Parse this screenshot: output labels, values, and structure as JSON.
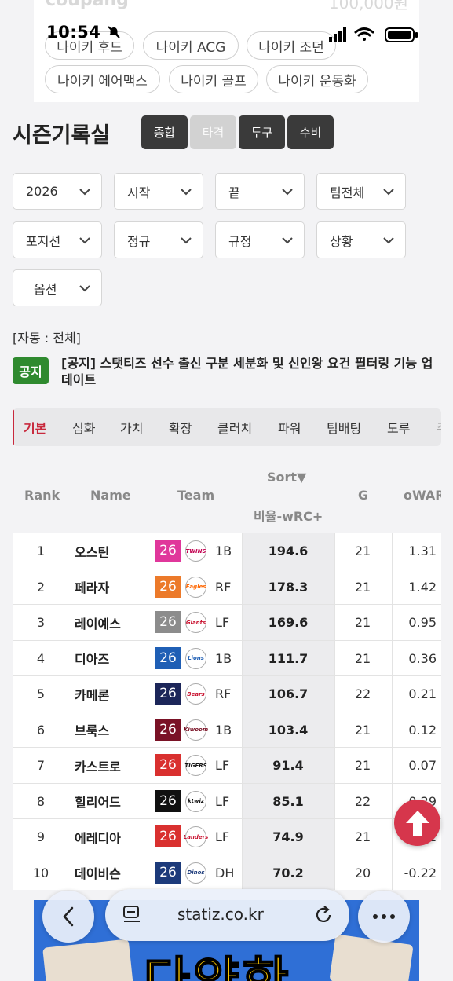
{
  "status_bar": {
    "time": "10:54"
  },
  "top_ad": {
    "brand": "coupang",
    "price": "100,000원",
    "chips": [
      "나이키 후드",
      "나이키 ACG",
      "나이키 조던",
      "나이키 에어맥스",
      "나이키 골프",
      "나이키 운동화"
    ]
  },
  "page_title": "시즌기록실",
  "record_tabs": [
    {
      "label": "종합",
      "active": false
    },
    {
      "label": "타격",
      "active": true
    },
    {
      "label": "투구",
      "active": false
    },
    {
      "label": "수비",
      "active": false
    }
  ],
  "filters": [
    "2026",
    "시작",
    "끝",
    "팀전체",
    "포지션",
    "정규",
    "규정",
    "상황",
    "옵션"
  ],
  "auto_label": "[자동 : 전체]",
  "notice": {
    "badge": "공지",
    "text": "[공지] 스탯티즈 선수 출신 구분 세분화 및 신인왕 요건 필터링 기능 업데이트"
  },
  "category_tabs": [
    "기본",
    "심화",
    "가치",
    "확장",
    "클러치",
    "파워",
    "팀배팅",
    "도루",
    "주"
  ],
  "table": {
    "headers": {
      "rank": "Rank",
      "name": "Name",
      "team": "Team",
      "sort": "Sort▼",
      "stat": "비율-wRC+",
      "g": "G",
      "owar": "oWAR"
    },
    "rows": [
      {
        "rank": "1",
        "name": "오스틴",
        "year": "26",
        "team_logo": "TWINS",
        "team_color": "#e0379b",
        "logo_color": "#c30452",
        "pos": "1B",
        "wrc": "194.6",
        "g": "21",
        "owar": "1.31"
      },
      {
        "rank": "2",
        "name": "페라자",
        "year": "26",
        "team_logo": "Eagles",
        "team_color": "#ec7a2a",
        "logo_color": "#ff6600",
        "pos": "RF",
        "wrc": "178.3",
        "g": "21",
        "owar": "1.42"
      },
      {
        "rank": "3",
        "name": "레이예스",
        "year": "26",
        "team_logo": "Giants",
        "team_color": "#8c8c8c",
        "logo_color": "#c8102e",
        "pos": "LF",
        "wrc": "169.6",
        "g": "21",
        "owar": "0.95"
      },
      {
        "rank": "4",
        "name": "디아즈",
        "year": "26",
        "team_logo": "Lions",
        "team_color": "#1f5fb5",
        "logo_color": "#1f5fb5",
        "pos": "1B",
        "wrc": "111.7",
        "g": "21",
        "owar": "0.36"
      },
      {
        "rank": "5",
        "name": "카메론",
        "year": "26",
        "team_logo": "Bears",
        "team_color": "#1c2659",
        "logo_color": "#c8102e",
        "pos": "RF",
        "wrc": "106.7",
        "g": "22",
        "owar": "0.21"
      },
      {
        "rank": "6",
        "name": "브룩스",
        "year": "26",
        "team_logo": "Kiwoom",
        "team_color": "#7a1226",
        "logo_color": "#7a1226",
        "pos": "1B",
        "wrc": "103.4",
        "g": "21",
        "owar": "0.12"
      },
      {
        "rank": "7",
        "name": "카스트로",
        "year": "26",
        "team_logo": "TIGERS",
        "team_color": "#d9302f",
        "logo_color": "#111111",
        "pos": "LF",
        "wrc": "91.4",
        "g": "21",
        "owar": "0.07"
      },
      {
        "rank": "8",
        "name": "힐리어드",
        "year": "26",
        "team_logo": "ktwiz",
        "team_color": "#111111",
        "logo_color": "#111111",
        "pos": "LF",
        "wrc": "85.1",
        "g": "22",
        "owar": "0.29"
      },
      {
        "rank": "9",
        "name": "에레디아",
        "year": "26",
        "team_logo": "Landers",
        "team_color": "#d9302f",
        "logo_color": "#c8102e",
        "pos": "LF",
        "wrc": "74.9",
        "g": "21",
        "owar": "-0.01"
      },
      {
        "rank": "10",
        "name": "데이비슨",
        "year": "26",
        "team_logo": "Dinos",
        "team_color": "#1c3a7a",
        "logo_color": "#1c3a7a",
        "pos": "DH",
        "wrc": "70.2",
        "g": "20",
        "owar": "-0.22"
      }
    ]
  },
  "browser": {
    "url": "statiz.co.kr"
  },
  "bottom_ad": {
    "text": "다양한"
  }
}
